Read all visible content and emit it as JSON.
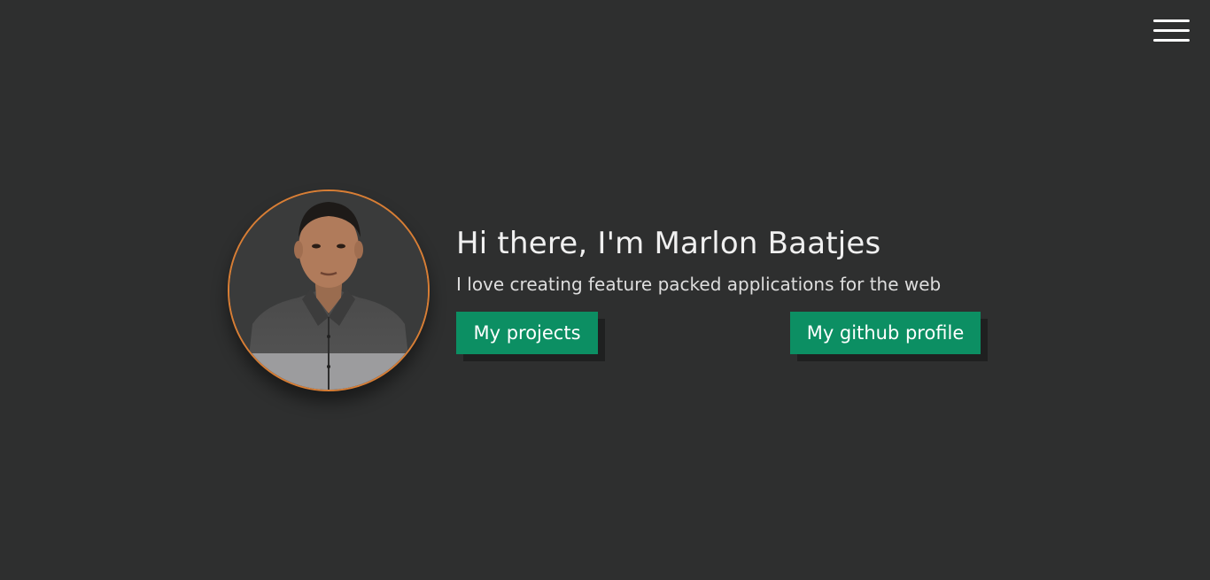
{
  "nav": {
    "menu_icon": "hamburger-menu-icon"
  },
  "hero": {
    "avatar_description": "profile-photo",
    "accent_color": "#d87e35",
    "title": "Hi there, I'm Marlon Baatjes",
    "subtitle": "I love creating feature packed applications for the web"
  },
  "actions": {
    "projects_label": "My projects",
    "github_label": "My github profile",
    "button_color": "#0c8f63"
  }
}
